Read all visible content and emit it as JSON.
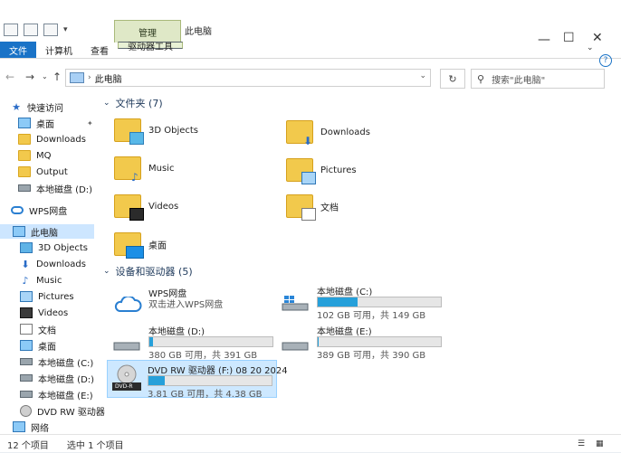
{
  "window": {
    "context_tab": "管理",
    "title": "此电脑"
  },
  "ribbon": {
    "tabs": [
      "文件",
      "计算机",
      "查看",
      "驱动器工具"
    ]
  },
  "address": {
    "path": "此电脑",
    "search_placeholder": "搜索\"此电脑\""
  },
  "nav": {
    "items": [
      {
        "label": "快速访问",
        "icon": "star-icon"
      },
      {
        "label": "桌面",
        "icon": "desktop-icon"
      },
      {
        "label": "Downloads",
        "icon": "folder-icon"
      },
      {
        "label": "MQ",
        "icon": "folder-icon"
      },
      {
        "label": "Output",
        "icon": "folder-icon"
      },
      {
        "label": "本地磁盘 (D:)",
        "icon": "drive-icon"
      },
      {
        "label": "WPS网盘",
        "icon": "cloud-icon"
      },
      {
        "label": "此电脑",
        "icon": "computer-icon"
      },
      {
        "label": "3D Objects",
        "icon": "3d-objects-icon"
      },
      {
        "label": "Downloads",
        "icon": "download-icon"
      },
      {
        "label": "Music",
        "icon": "music-icon"
      },
      {
        "label": "Pictures",
        "icon": "pictures-icon"
      },
      {
        "label": "Videos",
        "icon": "videos-icon"
      },
      {
        "label": "文档",
        "icon": "document-icon"
      },
      {
        "label": "桌面",
        "icon": "desktop-icon"
      },
      {
        "label": "本地磁盘 (C:)",
        "icon": "drive-icon"
      },
      {
        "label": "本地磁盘 (D:)",
        "icon": "drive-icon"
      },
      {
        "label": "本地磁盘 (E:)",
        "icon": "drive-icon"
      },
      {
        "label": "DVD RW 驱动器",
        "icon": "dvd-icon"
      },
      {
        "label": "网络",
        "icon": "network-icon"
      }
    ]
  },
  "folders": {
    "header": "文件夹 (7)",
    "items": [
      {
        "label": "3D Objects"
      },
      {
        "label": "Downloads"
      },
      {
        "label": "Music"
      },
      {
        "label": "Pictures"
      },
      {
        "label": "Videos"
      },
      {
        "label": "文档"
      },
      {
        "label": "桌面"
      }
    ]
  },
  "devices": {
    "header": "设备和驱动器 (5)",
    "items": [
      {
        "name": "WPS网盘",
        "sub": "双击进入WPS网盘"
      },
      {
        "name": "本地磁盘 (C:)",
        "cap": "102 GB 可用，共 149 GB",
        "used_fraction": 0.32
      },
      {
        "name": "本地磁盘 (D:)",
        "cap": "380 GB 可用，共 391 GB",
        "used_fraction": 0.03
      },
      {
        "name": "本地磁盘 (E:)",
        "cap": "389 GB 可用，共 390 GB",
        "used_fraction": 0.01
      },
      {
        "name": "DVD RW 驱动器 (F:) 08 20 2024",
        "cap": "3.81 GB 可用，共 4.38 GB",
        "used_fraction": 0.13,
        "badge": "DVD-R"
      }
    ]
  },
  "status": {
    "count": "12 个项目",
    "selected": "选中 1 个项目"
  }
}
